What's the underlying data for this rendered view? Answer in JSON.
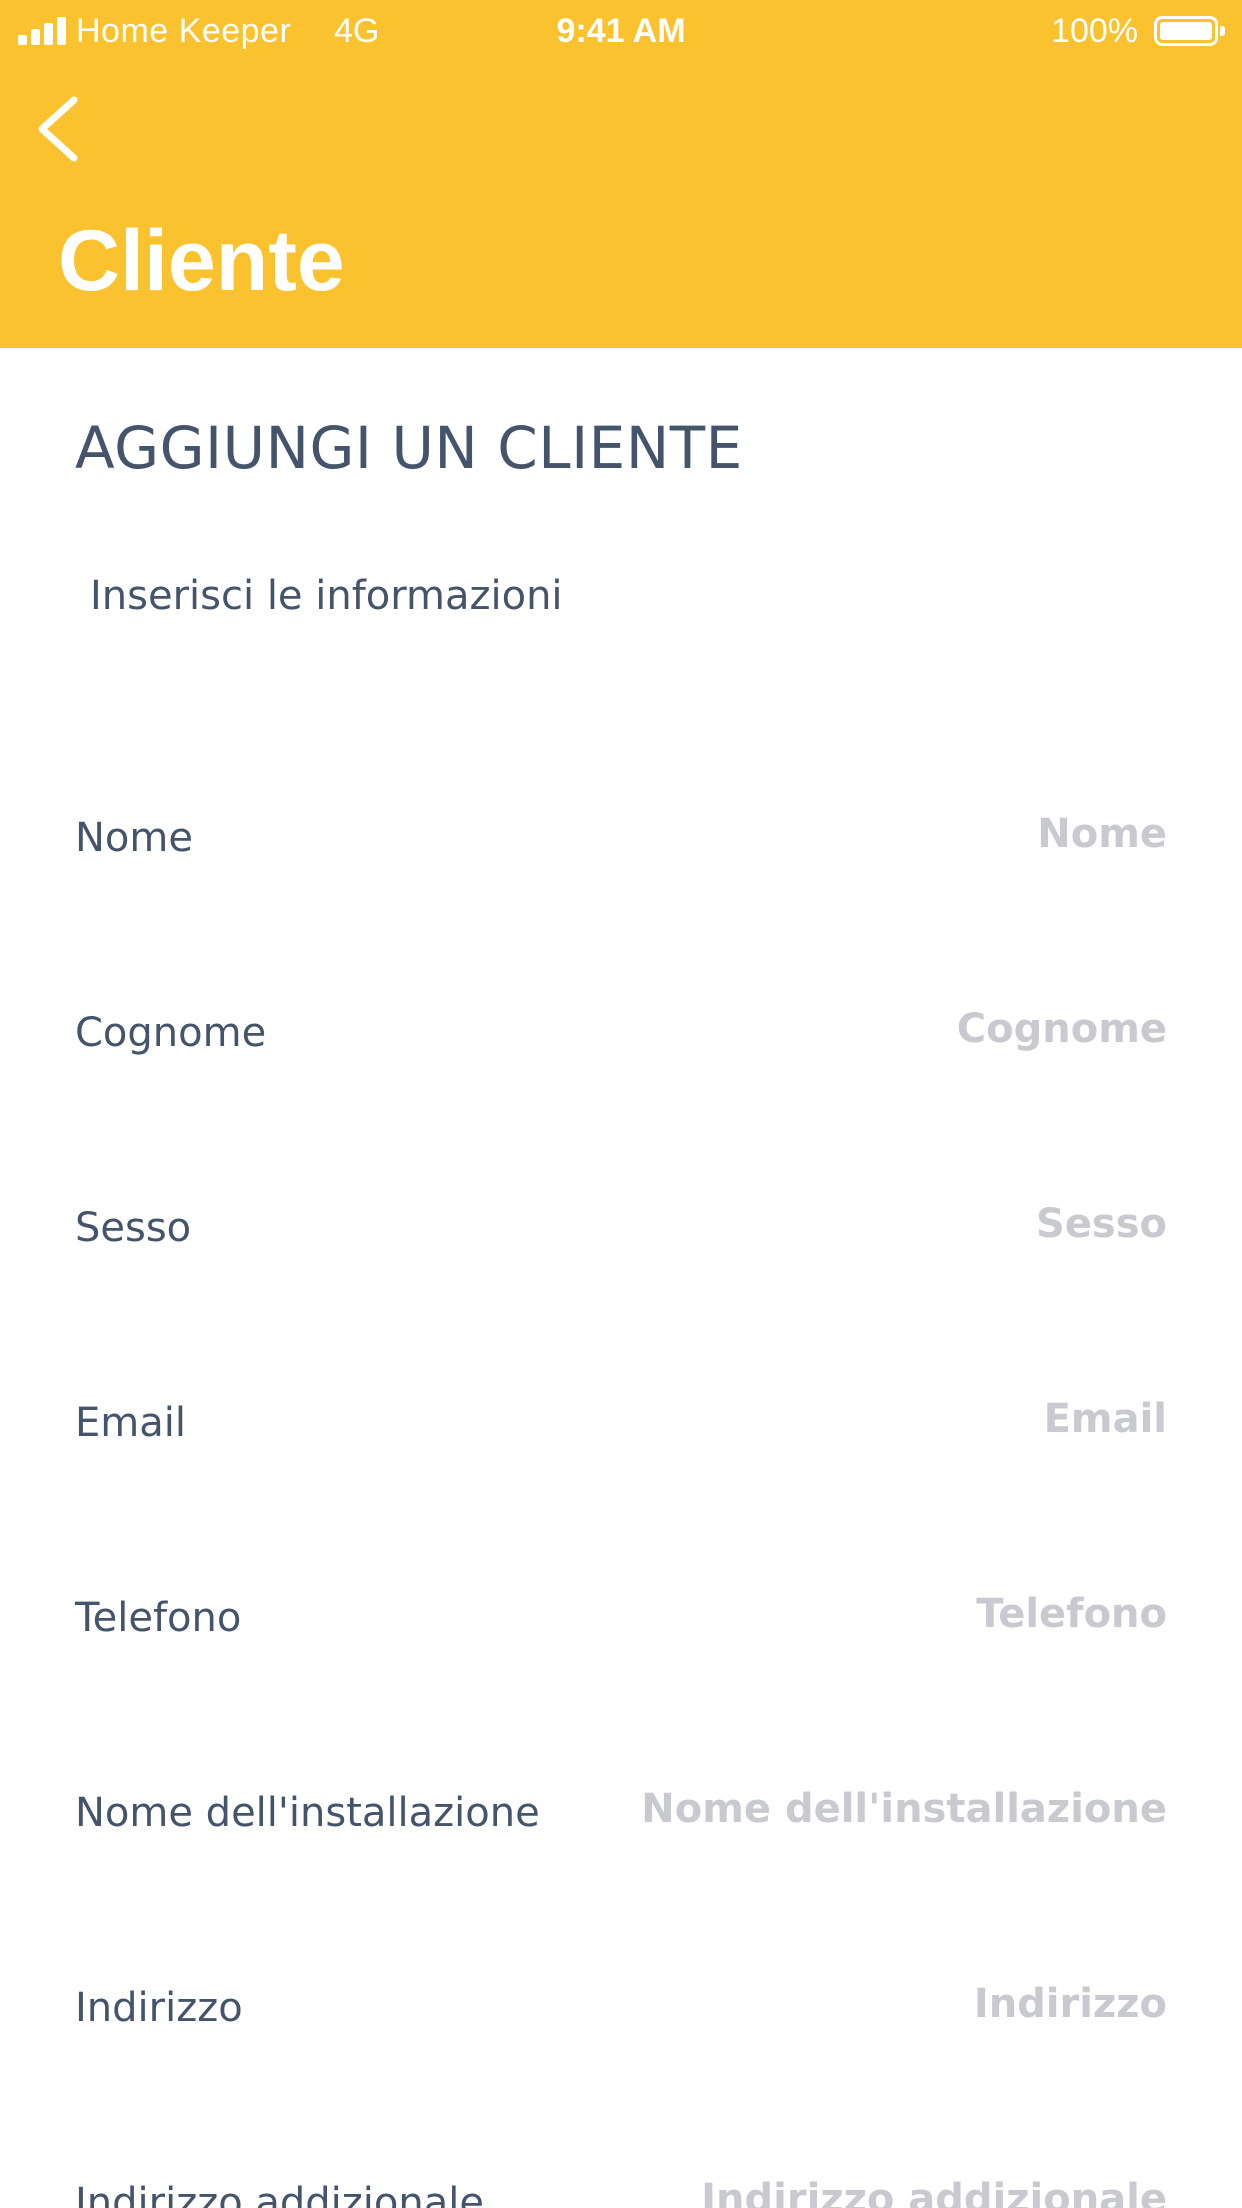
{
  "status_bar": {
    "carrier": "Home Keeper",
    "network": "4G",
    "time": "9:41 AM",
    "battery": "100%",
    "battery_level": 1.0
  },
  "header": {
    "back_icon": "chevron-left-icon",
    "title": "Cliente",
    "background_color": "#F9C22E"
  },
  "form": {
    "section_title": "AGGIUNGI UN CLIENTE",
    "section_subtitle": "Inserisci le informazioni",
    "fields": [
      {
        "label": "Nome",
        "placeholder": "Nome",
        "value": ""
      },
      {
        "label": "Cognome",
        "placeholder": "Cognome",
        "value": ""
      },
      {
        "label": "Sesso",
        "placeholder": "Sesso",
        "value": ""
      },
      {
        "label": "Email",
        "placeholder": "Email",
        "value": ""
      },
      {
        "label": "Telefono",
        "placeholder": "Telefono",
        "value": ""
      },
      {
        "label": "Nome dell'installazione",
        "placeholder": "Nome dell'installazione",
        "value": ""
      },
      {
        "label": "Indirizzo",
        "placeholder": "Indirizzo",
        "value": ""
      },
      {
        "label": "Indirizzo addizionale",
        "placeholder": "Indirizzo addizionale",
        "value": ""
      }
    ]
  },
  "colors": {
    "accent": "#F9C22E",
    "text": "#44546A",
    "placeholder": "#C8CACF"
  }
}
